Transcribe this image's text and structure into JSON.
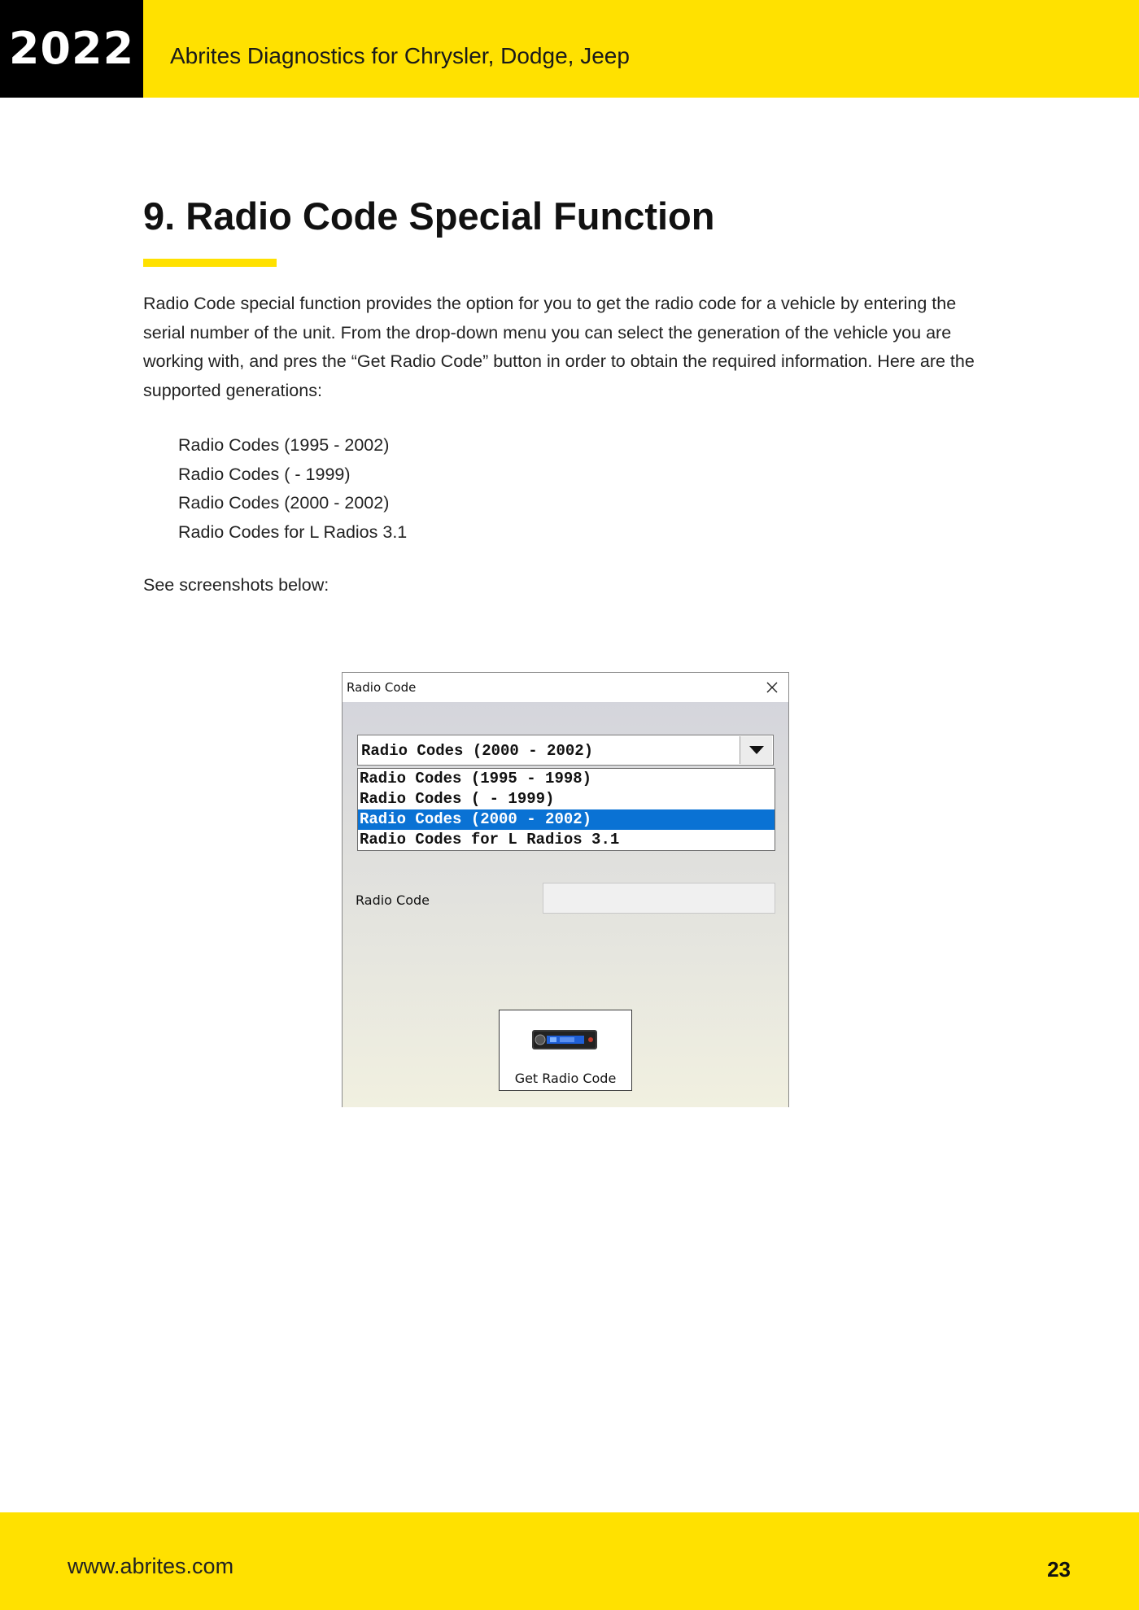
{
  "header": {
    "year": "2022",
    "title": "Abrites Diagnostics for Chrysler, Dodge, Jeep"
  },
  "section": {
    "title": "9. Radio Code Special Function",
    "intro": "Radio Code special function provides the option for you to get the radio code for a vehicle by entering the serial number of the unit. From the drop-down menu you can select the generation of the vehicle you are working with, and pres the “Get Radio Code” button in order to obtain the required information. Here are the supported generations:",
    "generations": [
      "Radio Codes (1995 - 2002)",
      "Radio Codes ( - 1999)",
      "Radio Codes (2000 - 2002)",
      "Radio Codes for L Radios 3.1"
    ],
    "see_below": "See screenshots below:"
  },
  "dialog": {
    "title": "Radio Code",
    "combo_value": "Radio Codes (2000 - 2002)",
    "dropdown_options": [
      "Radio Codes (1995 - 1998)",
      "Radio Codes ( - 1999)",
      "Radio Codes (2000 - 2002)",
      "Radio Codes for L Radios 3.1"
    ],
    "selected_option": "Radio Codes (2000 - 2002)",
    "radio_code_label": "Radio Code",
    "radio_code_value": "",
    "get_code_button": "Get Radio Code"
  },
  "footer": {
    "url": "www.abrites.com",
    "page": "23"
  },
  "colors": {
    "brand_yellow": "#ffe100",
    "selection_blue": "#0a72d4"
  },
  "icons": {
    "close": "close-icon",
    "dropdown": "chevron-down-icon",
    "button": "car-radio-icon"
  }
}
